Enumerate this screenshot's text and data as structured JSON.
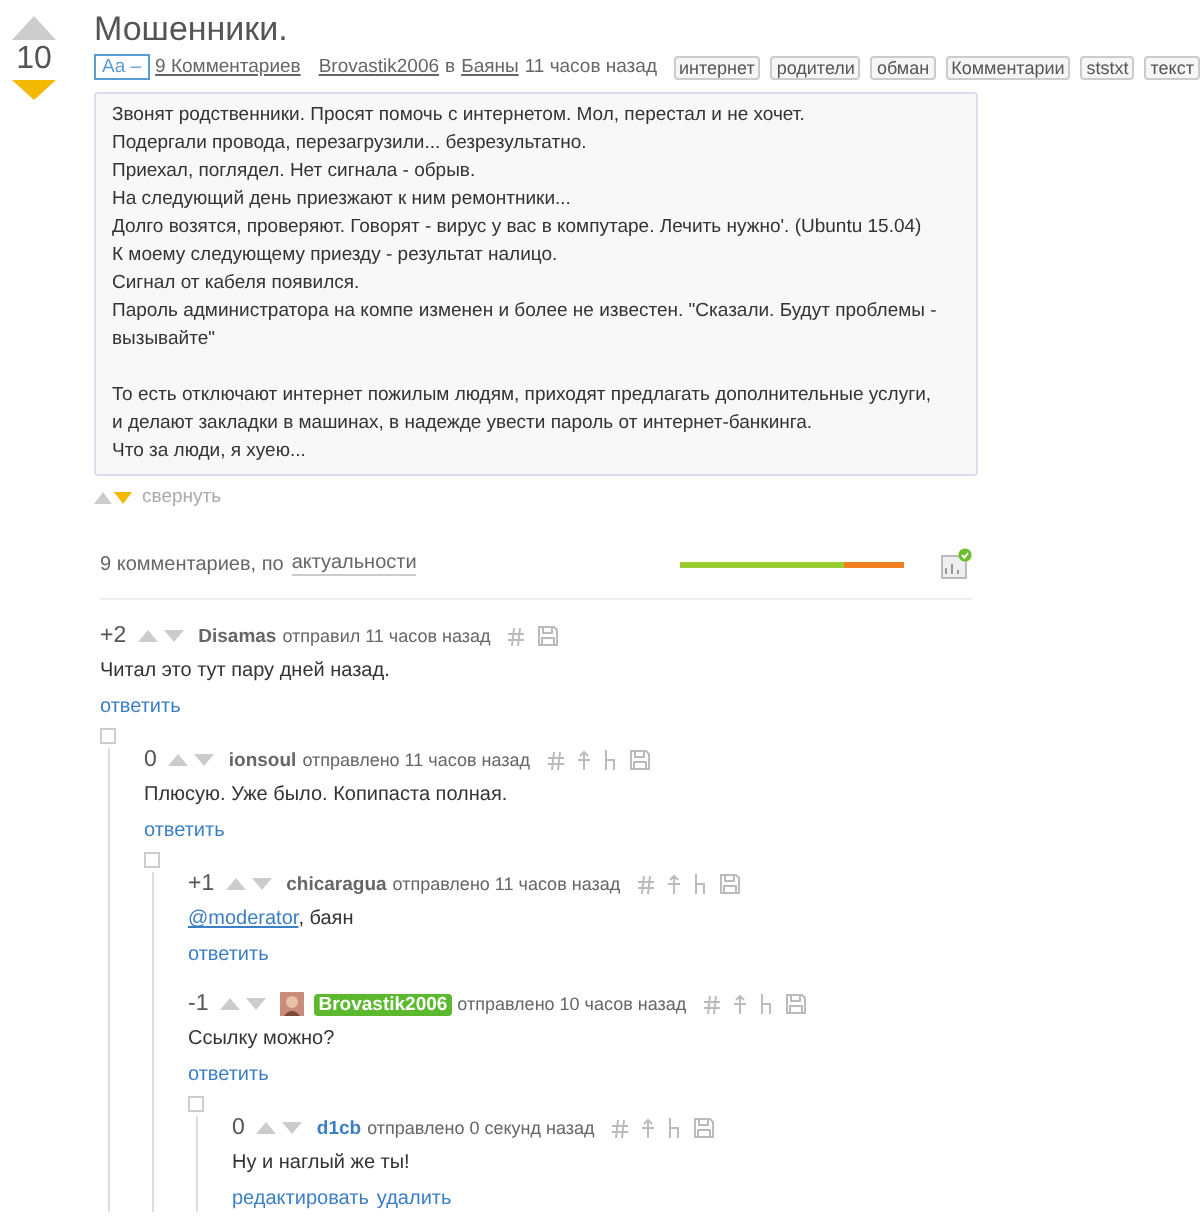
{
  "post": {
    "rating": "10",
    "voted_down": true,
    "title": "Мошенники.",
    "font_toggle": "Aa –",
    "comments_link": "9 Комментариев",
    "author": "Brovastik2006",
    "in_word": "в",
    "community": "Баяны",
    "time": "11 часов назад",
    "tags": [
      "интернет",
      "родители",
      "обман",
      "Комментарии",
      "ststxt",
      "текст"
    ],
    "paragraphs": [
      [
        "Звонят родственники. Просят помочь с интернетом. Мол, перестал и не хочет.",
        "Подергали провода, перезагрузили... безрезультатно.",
        "Приехал, поглядел. Нет сигнала - обрыв.",
        "На следующий день приезжают к ним ремонтники...",
        "Долго возятся, проверяют. Говорят - вирус у вас в компутаре. Лечить нужно'. (Ubuntu 15.04)",
        "К моему следующему приезду - результат налицо.",
        "Сигнал от кабеля появился.",
        "Пароль администратора на компе изменен и более не известен. \"Сказали. Будут проблемы - вызывайте\""
      ],
      [
        "То есть отключают интернет пожилым людям, приходят предлагать дополнительные услуги,",
        "и делают закладки в машинах, в надежде увести пароль от интернет-банкинга.",
        "Что за люди, я хуею..."
      ]
    ],
    "collapse": "свернуть"
  },
  "comments_header": {
    "count": "9 комментариев, по",
    "sort": "актуальности",
    "rating_bar": {
      "level": 0.73
    }
  },
  "comments": [
    {
      "score": "+2",
      "author": "Disamas",
      "kind": "normal",
      "verb": "отправил",
      "time": "11 часов назад",
      "extended_tools": false,
      "text": "Читал это тут пару дней назад.",
      "actions": [
        "ответить"
      ],
      "children": [
        {
          "score": "0",
          "author": "ionsoul",
          "kind": "normal",
          "verb": "отправлено",
          "time": "11 часов назад",
          "extended_tools": true,
          "text": "Плюсую. Уже было. Копипаста полная.",
          "actions": [
            "ответить"
          ],
          "children": [
            {
              "score": "+1",
              "author": "chicaragua",
              "kind": "normal",
              "verb": "отправлено",
              "time": "11 часов назад",
              "extended_tools": true,
              "mention": "@moderator",
              "text": ", баян",
              "actions": [
                "ответить"
              ]
            },
            {
              "score": "-1",
              "author": "Brovastik2006",
              "kind": "op",
              "verb": "отправлено",
              "time": "10 часов назад",
              "extended_tools": true,
              "text": "Ссылку можно?",
              "actions": [
                "ответить"
              ],
              "children": [
                {
                  "score": "0",
                  "author": "d1cb",
                  "kind": "self",
                  "verb": "отправлено",
                  "time": "0 секунд назад",
                  "extended_tools": true,
                  "text": "Ну и наглый же ты!",
                  "actions": [
                    "редактировать",
                    "удалить"
                  ]
                }
              ]
            }
          ]
        }
      ]
    }
  ]
}
